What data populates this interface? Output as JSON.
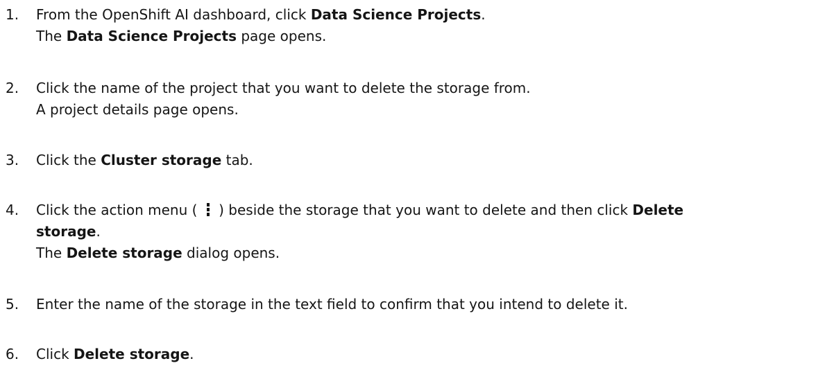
{
  "steps": [
    {
      "number": "1.",
      "line1": {
        "a": "From the OpenShift AI dashboard, click ",
        "b": "Data Science Projects",
        "c": "."
      },
      "line2": {
        "a": "The ",
        "b": "Data Science Projects",
        "c": " page opens."
      }
    },
    {
      "number": "2.",
      "line1": "Click the name of the project that you want to delete the storage from.",
      "line2": "A project details page opens."
    },
    {
      "number": "3.",
      "line1": {
        "a": "Click the ",
        "b": "Cluster storage",
        "c": " tab."
      }
    },
    {
      "number": "4.",
      "line1": {
        "a": "Click the action menu ( ",
        "icon": "kebab-menu-icon",
        "c": " ) beside the storage that you want to delete and then click ",
        "d": "Delete"
      },
      "line2": {
        "b": "storage",
        "c": "."
      },
      "line3": {
        "a": "The ",
        "b": "Delete storage",
        "c": " dialog opens."
      }
    },
    {
      "number": "5.",
      "line1": "Enter the name of the storage in the text field to confirm that you intend to delete it."
    },
    {
      "number": "6.",
      "line1": {
        "a": "Click ",
        "b": "Delete storage",
        "c": "."
      }
    }
  ]
}
